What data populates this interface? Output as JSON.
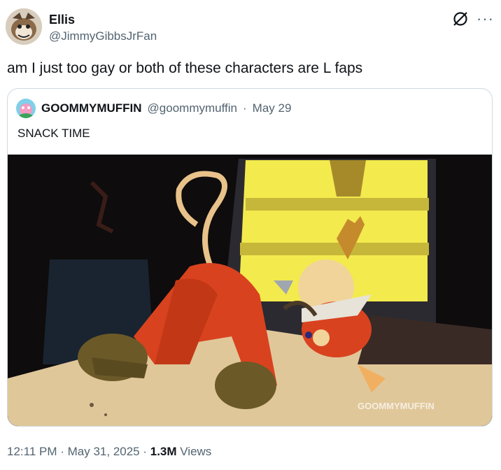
{
  "author": {
    "name": "Ellis",
    "handle": "@JimmyGibbsJrFan",
    "avatar_icon": "user-avatar-illustration"
  },
  "header_icons": [
    "grok-icon",
    "more-options-icon"
  ],
  "more_label": "···",
  "tweet": {
    "text": "am I just too gay or both of these characters are L faps"
  },
  "quoted": {
    "name": "GOOMMYMUFFIN",
    "handle": "@goommymuffin",
    "separator": "·",
    "date": "May 29",
    "text": "SNACK TIME",
    "media_watermark": "GOOMMYMUFFIN",
    "avatar_icon": "colorful-avatar"
  },
  "meta": {
    "time": "12:11 PM",
    "sep1": " · ",
    "date": "May 31, 2025",
    "sep2": " · ",
    "views_count": "1.3M",
    "views_label": " Views"
  },
  "colors": {
    "text_primary": "#0f1419",
    "text_secondary": "#536471",
    "border": "#cfd9de",
    "window_yellow": "#f6ea4b",
    "character_red": "#d9421f"
  }
}
